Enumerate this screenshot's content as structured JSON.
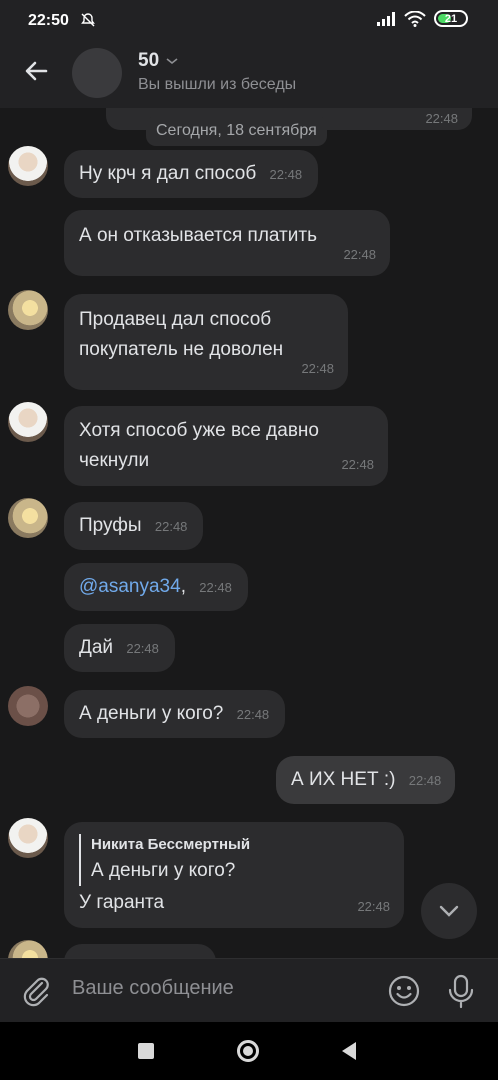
{
  "status_bar": {
    "time": "22:50",
    "battery": "21",
    "icons": [
      "mute-icon",
      "signal-icon",
      "wifi-icon",
      "battery-icon"
    ]
  },
  "header": {
    "title": "50",
    "subtitle": "Вы вышли из беседы"
  },
  "chat": {
    "prev_time": "22:48",
    "date_separator": "Сегодня, 18 сентября",
    "messages": [
      {
        "text": "Ну крч я дал способ",
        "time": "22:48"
      },
      {
        "text": "А он отказывается платить",
        "time": "22:48"
      },
      {
        "text_lines": [
          "Продавец дал способ",
          "покупатель не доволен"
        ],
        "time": "22:48"
      },
      {
        "text_lines": [
          "Хотя способ уже все давно",
          "чекнули"
        ],
        "time": "22:48"
      },
      {
        "text": "Пруфы",
        "time": "22:48"
      },
      {
        "mention": "@asanya34",
        "suffix": ",",
        "time": "22:48"
      },
      {
        "text": "Дай",
        "time": "22:48"
      },
      {
        "text": "А деньги у кого?",
        "time": "22:48"
      },
      {
        "text": "А ИХ НЕТ :)",
        "time": "22:48",
        "outgoing": true
      },
      {
        "reply_author": "Никита Бессмертный",
        "reply_text": "А деньги у кого?",
        "text": "У гаранта",
        "time": "22:48"
      }
    ]
  },
  "composer": {
    "placeholder": "Ваше сообщение"
  },
  "colors": {
    "background": "#19191a",
    "bubble": "#2c2c2e",
    "link": "#71aaeb"
  }
}
